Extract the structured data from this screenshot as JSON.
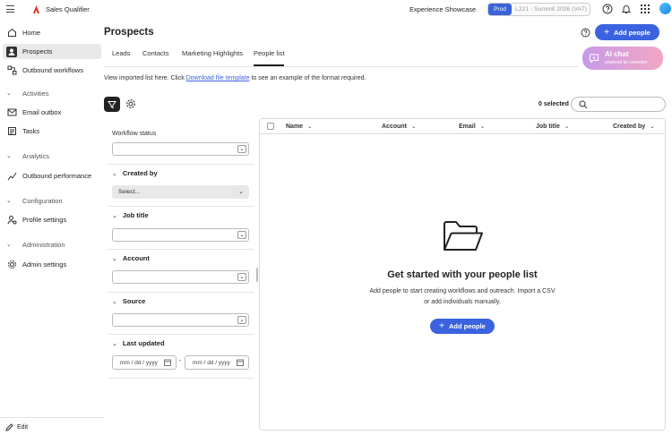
{
  "app": {
    "name": "Sales Qualifier",
    "workspace": "Experience Showcase"
  },
  "env": {
    "badge": "Prod",
    "name": "L221 - Summit 2026 (VA7)"
  },
  "sidebar": {
    "home": "Home",
    "prospects": "Prospects",
    "outbound_workflows": "Outbound workflows",
    "activities_group": "Activities",
    "email_outbox": "Email outbox",
    "tasks": "Tasks",
    "analytics_group": "Analytics",
    "outbound_performance": "Outbound performance",
    "configuration_group": "Configuration",
    "profile_settings": "Profile settings",
    "administration_group": "Administration",
    "admin_settings": "Admin settings",
    "edit": "Edit"
  },
  "page": {
    "title": "Prospects",
    "add_people": "Add people"
  },
  "tabs": [
    "Leads",
    "Contacts",
    "Marketing Highlights",
    "People list"
  ],
  "ai_chat": {
    "title": "AI chat",
    "subtitle": "powered by coworker"
  },
  "info": {
    "before": "View imported list here. Click ",
    "link": "Download file template",
    "after": " to see an example of the format required."
  },
  "selection": {
    "count": "0 selected"
  },
  "filters": {
    "workflow_status": "Workflow status",
    "created_by": "Created by",
    "created_by_value": "Select...",
    "job_title": "Job title",
    "account": "Account",
    "source": "Source",
    "last_updated": "Last updated",
    "date_placeholder": "mm / dd / yyyy",
    "date_separator": "-"
  },
  "table": {
    "columns": [
      "Name",
      "Account",
      "Email",
      "Job title",
      "Created by"
    ]
  },
  "empty_state": {
    "title": "Get started with your people list",
    "description": "Add people to start creating workflows and outreach. Import a CSV or add individuals manually.",
    "button": "Add people"
  },
  "colors": {
    "accent": "#3b63e0",
    "env_badge": "#3b63d8"
  }
}
